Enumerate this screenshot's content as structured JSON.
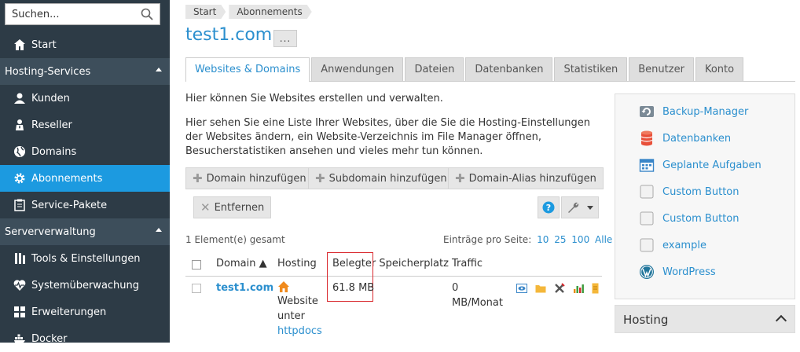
{
  "sidebar": {
    "search_placeholder": "Suchen...",
    "items": {
      "start": "Start",
      "hosting_services": "Hosting-Services",
      "kunden": "Kunden",
      "reseller": "Reseller",
      "domains": "Domains",
      "abonnements": "Abonnements",
      "service_pakete": "Service-Pakete",
      "serververwaltung": "Serververwaltung",
      "tools": "Tools & Einstellungen",
      "monitoring": "Systemüberwachung",
      "erweiterungen": "Erweiterungen",
      "docker": "Docker"
    }
  },
  "breadcrumbs": [
    "Start",
    "Abonnements"
  ],
  "page_title": "test1.com",
  "more_button": "...",
  "tabs": [
    "Websites & Domains",
    "Anwendungen",
    "Dateien",
    "Datenbanken",
    "Statistiken",
    "Benutzer",
    "Konto"
  ],
  "intro": "Hier können Sie Websites erstellen und verwalten.",
  "description": "Hier sehen Sie eine Liste Ihrer Websites, über die Sie die Hosting-Einstellungen der Websites ändern, ein Website-Verzeichnis im File Manager öffnen, Besucherstatistiken ansehen und vieles mehr tun können.",
  "toolbar": {
    "add_domain": "Domain hinzufügen",
    "add_subdomain": "Subdomain hinzufügen",
    "add_alias": "Domain-Alias hinzufügen",
    "remove": "Entfernen"
  },
  "list": {
    "total": "1 Element(e) gesamt",
    "per_page_label": "Einträge pro Seite:",
    "per_page_options": [
      "10",
      "25",
      "100",
      "Alle"
    ],
    "columns": {
      "domain": "Domain ▲",
      "hosting": "Hosting",
      "storage": "Belegter Speicherplatz",
      "traffic": "Traffic"
    },
    "rows": [
      {
        "domain": "test1.com",
        "hosting_line1": "Website",
        "hosting_line2": "unter",
        "hosting_link": "httpdocs",
        "storage": "61.8 MB",
        "traffic_line1": "0",
        "traffic_line2": "MB/Monat"
      }
    ]
  },
  "right_panel": {
    "items": [
      "Backup-Manager",
      "Datenbanken",
      "Geplante Aufgaben",
      "Custom Button",
      "Custom Button",
      "example",
      "WordPress"
    ]
  },
  "hosting_header": "Hosting",
  "colors": {
    "sidebar_bg": "#2d3b46",
    "active": "#1c9ae0",
    "link": "#2b8fce",
    "highlight": "#d9292e"
  }
}
